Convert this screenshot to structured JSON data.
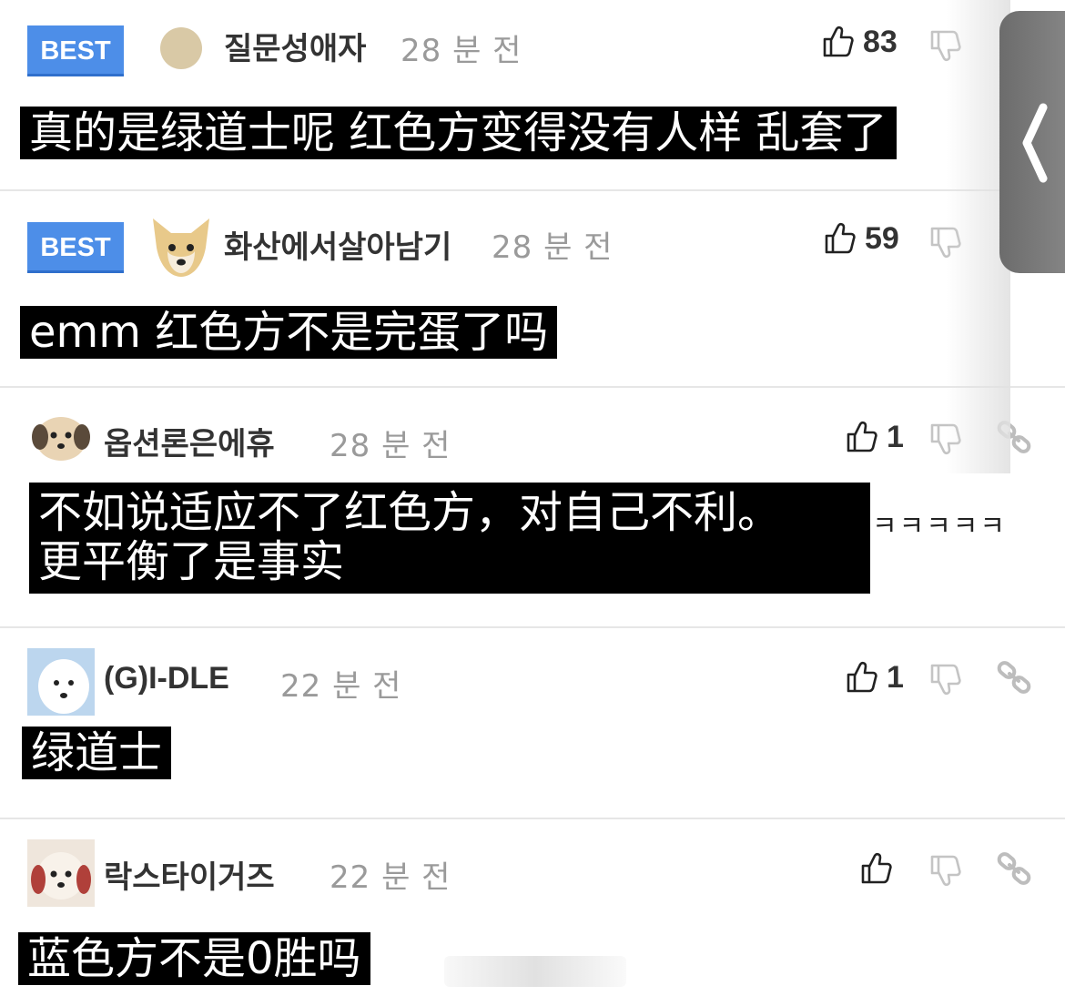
{
  "comments": [
    {
      "best_label": "BEST",
      "username": "질문성애자",
      "time": "28 분 전",
      "likes": "83",
      "caption": "真的是绿道士呢 红色方变得没有人样 乱套了"
    },
    {
      "best_label": "BEST",
      "username": "화산에서살아남기",
      "time": "28 분 전",
      "likes": "59",
      "caption": "emm 红色方不是完蛋了吗"
    },
    {
      "username": "옵션론은에휴",
      "time": "28 분 전",
      "likes": "1",
      "caption_line1": "不如说适应不了红色方，对自己不利。",
      "caption_line2": "更平衡了是事实",
      "trailing_text": "ㅋㅋㅋㅋㅋ"
    },
    {
      "username": "(G)I-DLE",
      "time": "22 분 전",
      "likes": "1",
      "caption": "绿道士"
    },
    {
      "username": "락스타이거즈",
      "time": "22 분 전",
      "likes": "",
      "caption": "蓝色方不是0胜吗"
    }
  ],
  "side_tab": {
    "icon": "chevron-left-icon"
  },
  "colors": {
    "best_badge": "#4d8ee8",
    "caption_bg": "#000000",
    "divider": "#e6e6e6"
  }
}
